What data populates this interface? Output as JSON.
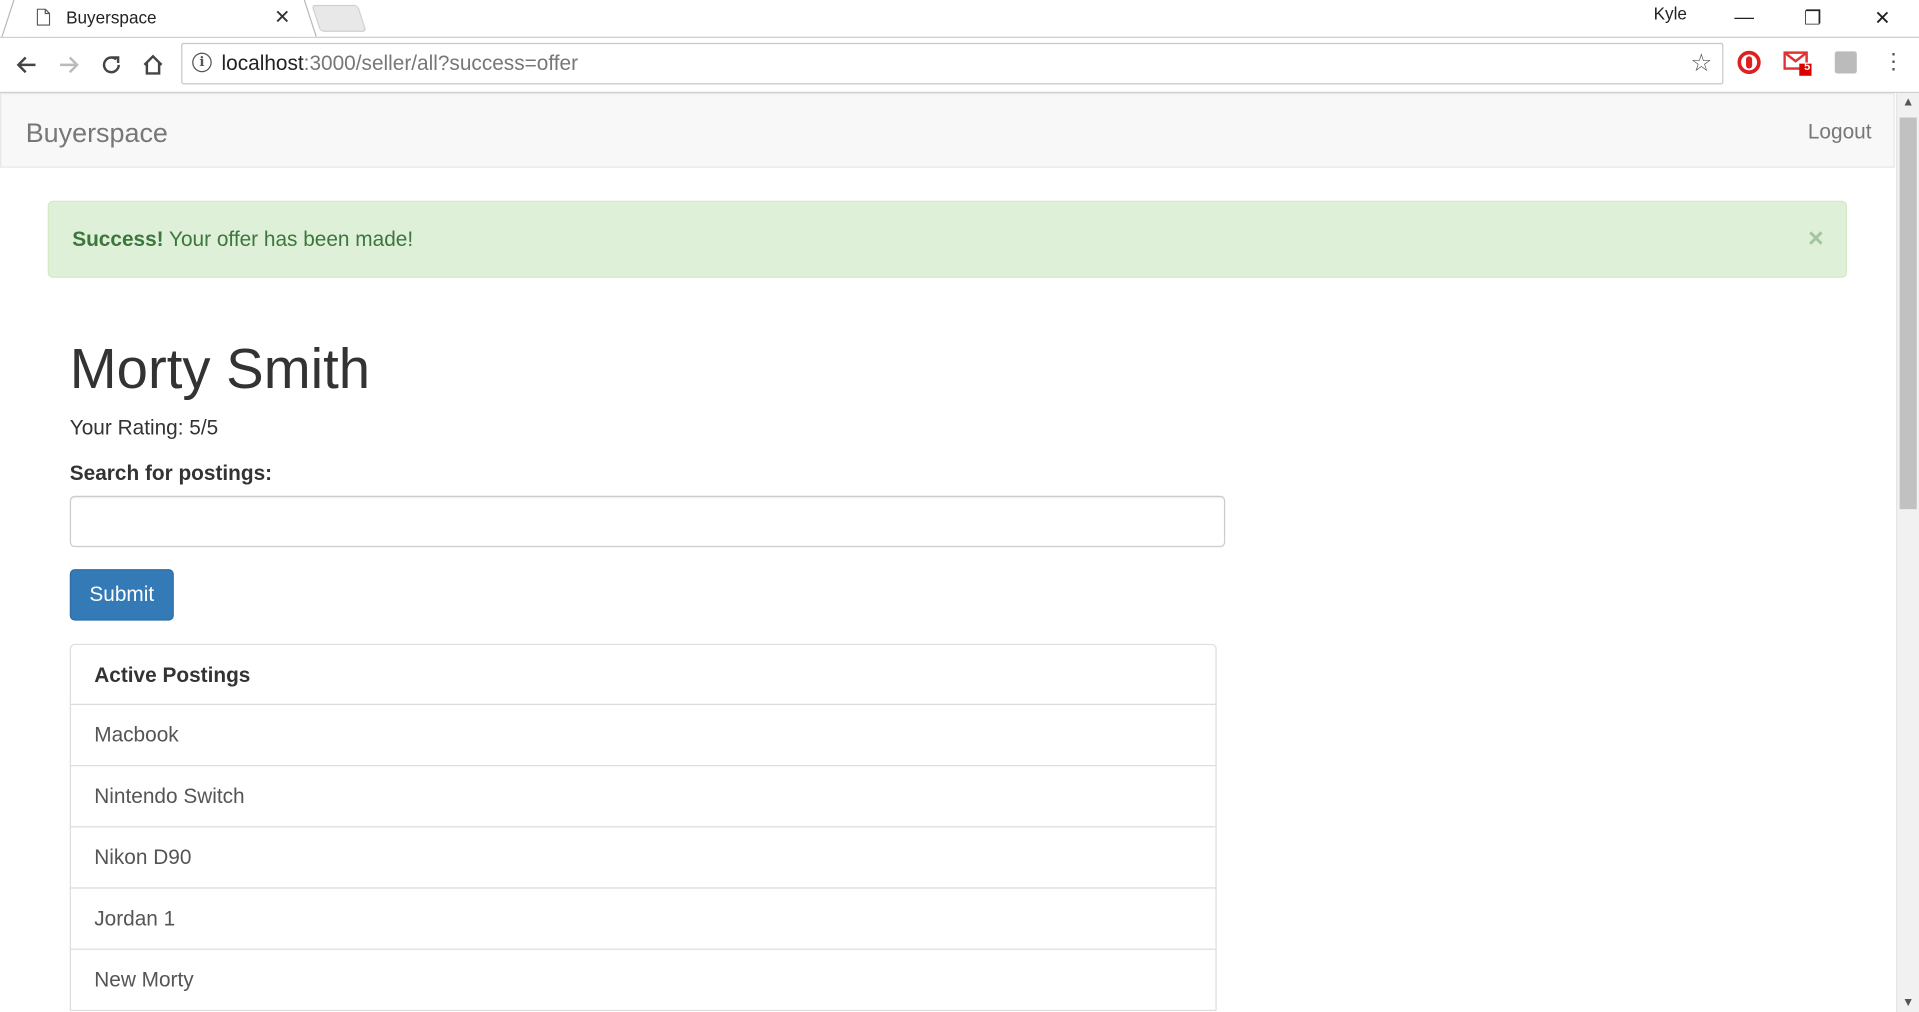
{
  "browser": {
    "tab_title": "Buyerspace",
    "tab_close": "✕",
    "profile_name": "Kyle",
    "url_host": "localhost",
    "url_rest": ":3000/seller/all?success=offer",
    "gmail_badge": "5",
    "window_controls": {
      "minimize": "—",
      "restore": "❐",
      "close": "✕"
    }
  },
  "navbar": {
    "brand": "Buyerspace",
    "logout": "Logout"
  },
  "alert": {
    "strong": "Success!",
    "message": " Your offer has been made!",
    "close": "×",
    "color": "#dff0d8"
  },
  "profile": {
    "name": "Morty Smith",
    "rating": "Your Rating: 5/5"
  },
  "search": {
    "label": "Search for postings:",
    "value": "",
    "submit": "Submit",
    "submit_color": "#337ab7"
  },
  "postings": {
    "header": "Active Postings",
    "items": [
      "Macbook",
      "Nintendo Switch",
      "Nikon D90",
      "Jordan 1",
      "New Morty"
    ]
  }
}
